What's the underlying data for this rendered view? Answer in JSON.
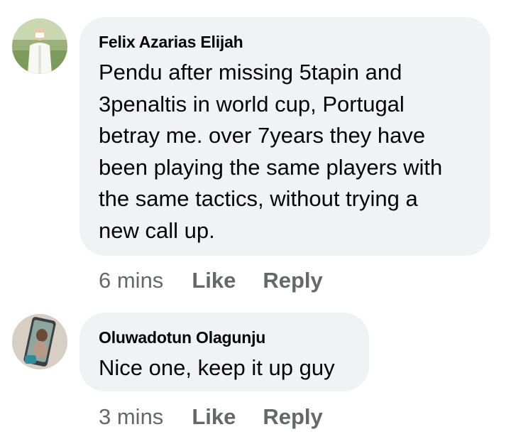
{
  "comments": [
    {
      "author": "Felix Azarias Elijah",
      "text": "Pendu after missing 5tapin and\n3penaltis in world cup, Portugal\nbetray me. over 7years they have\nbeen playing the same players with\nthe same tactics, without trying a\nnew call up.",
      "time": "6 mins",
      "like_label": "Like",
      "reply_label": "Reply"
    },
    {
      "author": "Oluwadotun Olagunju",
      "text": "Nice one, keep it up guy",
      "time": "3 mins",
      "like_label": "Like",
      "reply_label": "Reply"
    }
  ],
  "colors": {
    "bubble_bg": "#f0f2f5",
    "text": "#050505",
    "secondary": "#65676b"
  }
}
